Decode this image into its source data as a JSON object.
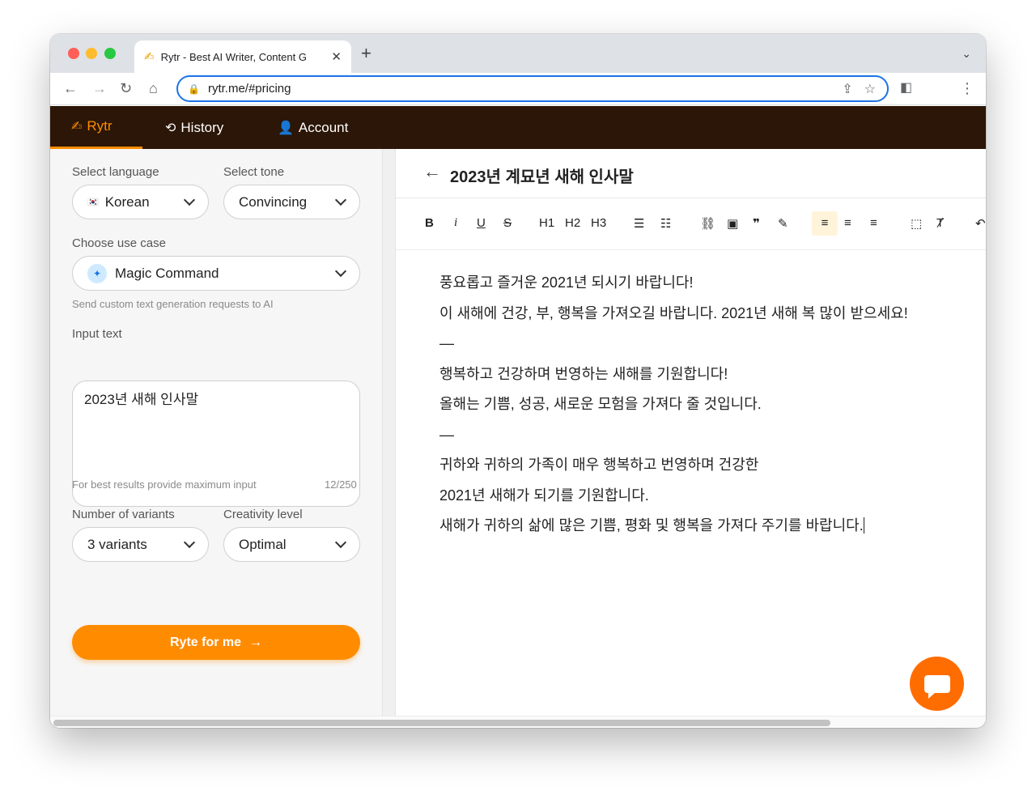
{
  "browser": {
    "tab_title": "Rytr - Best AI Writer, Content G",
    "tab_favicon": "✍",
    "url": "rytr.me/#pricing"
  },
  "app_nav": {
    "brand": "Rytr",
    "history": "History",
    "account": "Account"
  },
  "left_panel": {
    "language_label": "Select language",
    "language_value": "Korean",
    "language_flag": "🇰🇷",
    "tone_label": "Select tone",
    "tone_value": "Convincing",
    "use_case_label": "Choose use case",
    "use_case_value": "Magic Command",
    "use_case_hint": "Send custom text generation requests to AI",
    "input_label": "Input text",
    "input_value": "2023년 새해 인사말",
    "input_hint": "For best results provide maximum input",
    "input_count": "12/250",
    "variants_label": "Number of variants",
    "variants_value": "3 variants",
    "creativity_label": "Creativity level",
    "creativity_value": "Optimal",
    "ryte_button": "Ryte for me"
  },
  "editor": {
    "title": "2023년 계묘년 새해 인사말",
    "toolbar": [
      "B",
      "i",
      "U",
      "S",
      "H1",
      "H2",
      "H3"
    ],
    "lines": [
      "풍요롭고 즐거운 2021년 되시기 바랍니다!",
      "이 새해에 건강, 부, 행복을 가져오길 바랍니다. 2021년 새해 복 많이 받으세요!",
      "—",
      "행복하고 건강하며 번영하는 새해를 기원합니다!",
      "올해는 기쁨, 성공, 새로운 모험을 가져다 줄 것입니다.",
      "—",
      "귀하와 귀하의 가족이 매우 행복하고 번영하며 건강한",
      "2021년 새해가 되기를 기원합니다.",
      "새해가 귀하의 삶에 많은 기쁨, 평화 및 행복을 가져다 주기를 바랍니다."
    ]
  }
}
